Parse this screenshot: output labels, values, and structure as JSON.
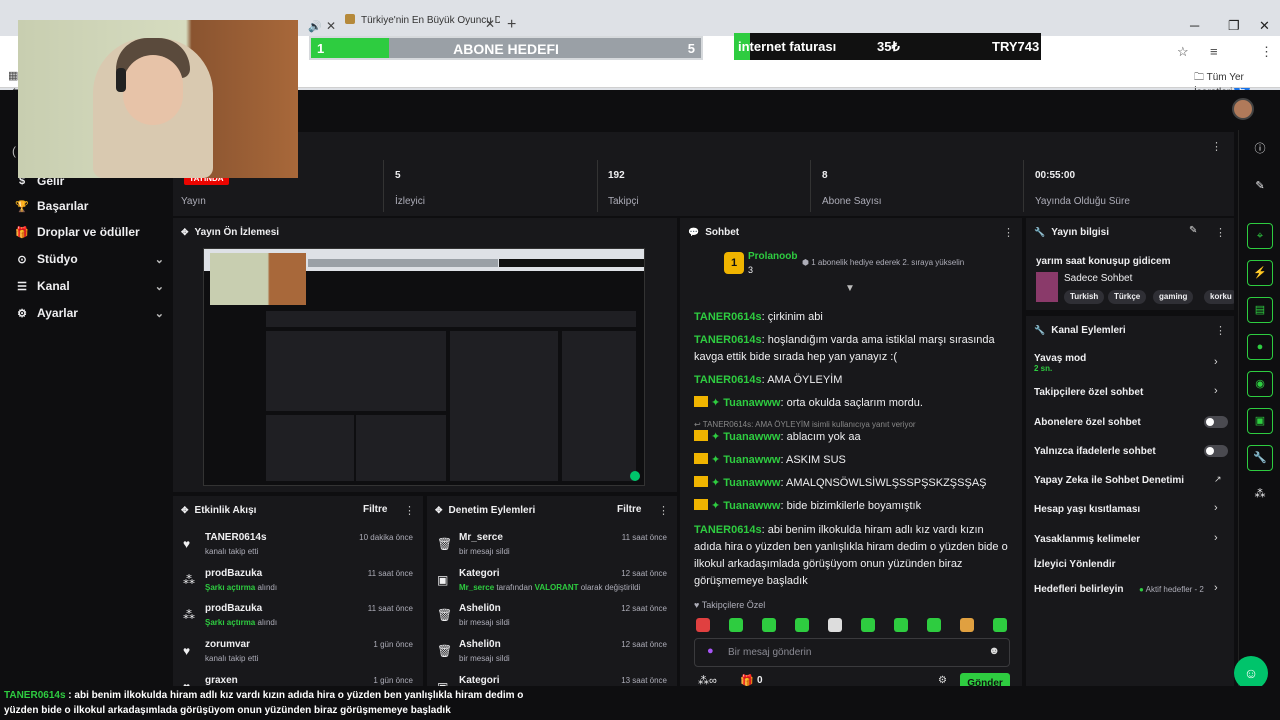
{
  "browser": {
    "tab2_title": "Türkiye'nin En Büyük Oyuncu D",
    "bookmarks_label": "Tüm Yer İşaretleri",
    "profile_letter": "E"
  },
  "overlays": {
    "sub_goal": {
      "label": "ABONE HEDEFI",
      "current": "1",
      "target": "5",
      "progress": 0.2
    },
    "bill_goal": {
      "label": "internet faturası",
      "amount": "35₺",
      "target": "TRY743"
    }
  },
  "nav": {
    "items": [
      {
        "label": "Gelir",
        "icon": "gelir-icon"
      },
      {
        "label": "Başarılar",
        "icon": "trophy-icon"
      },
      {
        "label": "Droplar ve ödüller",
        "icon": "gift-icon"
      },
      {
        "label": "Stüdyo",
        "icon": "studio-icon"
      },
      {
        "label": "Kanal",
        "icon": "channel-icon"
      },
      {
        "label": "Ayarlar",
        "icon": "gear-icon"
      }
    ]
  },
  "stats": {
    "live_badge": "YAYINDA",
    "stream_label": "Yayın",
    "viewers": "5",
    "viewers_label": "İzleyici",
    "followers": "192",
    "followers_label": "Takipçi",
    "subs": "8",
    "subs_label": "Abone Sayısı",
    "uptime": "00:55:00",
    "uptime_label": "Yayında Olduğu Süre"
  },
  "preview": {
    "title": "Yayın Ön İzlemesi"
  },
  "activity": {
    "title": "Etkinlik Akışı",
    "filter": "Filtre",
    "rows": [
      {
        "name": "TANER0614s",
        "sub": "kanalı takip etti",
        "time": "10 dakika önce",
        "green": false,
        "icon": "heart-icon"
      },
      {
        "name": "prodBazuka",
        "sub": "Şarkı açtırma",
        "sub2": "alındı",
        "time": "11 saat önce",
        "green": true,
        "icon": "reward-icon"
      },
      {
        "name": "prodBazuka",
        "sub": "Şarkı açtırma",
        "sub2": "alındı",
        "time": "11 saat önce",
        "green": true,
        "icon": "reward-icon"
      },
      {
        "name": "zorumvar",
        "sub": "kanalı takip etti",
        "time": "1 gün önce",
        "green": false,
        "icon": "heart-icon"
      },
      {
        "name": "graxen",
        "sub": "",
        "time": "1 gün önce",
        "green": false,
        "icon": "heart-icon"
      }
    ]
  },
  "moderation": {
    "title": "Denetim Eylemleri",
    "filter": "Filtre",
    "rows": [
      {
        "name": "Mr_serce",
        "sub": "bir mesajı sildi",
        "time": "11 saat önce",
        "icon": "trash-icon"
      },
      {
        "name": "Kategori",
        "sub_user": "Mr_serce",
        "sub_mid": "tarafından",
        "sub_game": "VALORANT",
        "sub_end": "olarak değiştirildi",
        "time": "12 saat önce",
        "icon": "category-icon"
      },
      {
        "name": "Asheli0n",
        "sub": "bir mesajı sildi",
        "time": "12 saat önce",
        "icon": "trash-icon"
      },
      {
        "name": "Asheli0n",
        "sub": "bir mesajı sildi",
        "time": "12 saat önce",
        "icon": "trash-icon"
      },
      {
        "name": "Kategori",
        "sub": "",
        "time": "13 saat önce",
        "icon": "category-icon"
      }
    ]
  },
  "chat": {
    "title": "Sohbet",
    "top_user": "Prolanoob",
    "top_count": "3",
    "top_badge": "1",
    "top_msg": "1 abonelik hediye ederek 2. sıraya yükselin",
    "messages": [
      {
        "user": "TANER0614s",
        "text": "çirkinim abi"
      },
      {
        "user": "TANER0614s",
        "text": "hoşlandığım varda ama istiklal marşı sırasında kavga ettik bide sırada hep yan yanayız :("
      },
      {
        "user": "TANER0614s",
        "text": "AMA ÖYLEYİM"
      },
      {
        "user": "Tuanawww",
        "text": "orta okulda saçlarım mordu."
      },
      {
        "user": "Tuanawww",
        "text": "ablacım yok aa"
      },
      {
        "user": "Tuanawww",
        "text": "ASKIM SUS"
      },
      {
        "user": "Tuanawww",
        "text": "AMALQNSÖWLSİWLŞSSPŞSKZŞSŞAŞ"
      },
      {
        "user": "Tuanawww",
        "text": "bide bizimkilerle boyamıştık"
      },
      {
        "user": "TANER0614s",
        "text": "abi benim ilkokulda hiram adlı kız vardı kızın adıda hira o yüzden ben yanlışlıkla hiram dedim o yüzden bide o ilkokul arkadaşımlada görüşüyom onun yüzünden biraz görüşmemeye başladık"
      }
    ],
    "reply_note": "TANER0614s: AMA ÖYLEYİM isimli kullanıcıya yanıt veriyor",
    "followers_only": "Takipçilere Özel",
    "input_placeholder": "Bir mesaj gönderin",
    "points": "0",
    "send": "Gönder"
  },
  "stream_info": {
    "title": "Yayın bilgisi",
    "stream_title": "yarım saat konuşup gidicem",
    "category": "Sadece Sohbet",
    "tags": [
      "Turkish",
      "Türkçe",
      "gaming",
      "korku"
    ]
  },
  "channel_actions": {
    "title": "Kanal Eylemleri",
    "slow_mode": "Yavaş mod",
    "slow_value": "2 sn.",
    "followers_chat": "Takipçilere özel sohbet",
    "subs_chat": "Abonelere özel sohbet",
    "emote_only": "Yalnızca ifadelerle sohbet",
    "ai_mod": "Yapay Zeka ile Sohbet Denetimi",
    "account_age": "Hesap yaşı kısıtlaması",
    "banned_words": "Yasaklanmış kelimeler",
    "redirect": "İzleyici Yönlendir",
    "goals": "Hedefleri belirleyin",
    "goals_status": "Aktif hedefler - 2"
  },
  "caption": {
    "user": "TANER0614s",
    "line1": " : abi benim ilkokulda hiram adlı kız vardı kızın adıda hira o yüzden ben yanlışlıkla hiram dedim o",
    "line2": "yüzden bide o ilkokul arkadaşımlada görüşüyom onun yüzünden biraz görüşmemeye başladık"
  },
  "colors": {
    "accent": "#2ecc40",
    "live": "#eb0400",
    "panel": "#18181b",
    "bg": "#0e0e10"
  }
}
